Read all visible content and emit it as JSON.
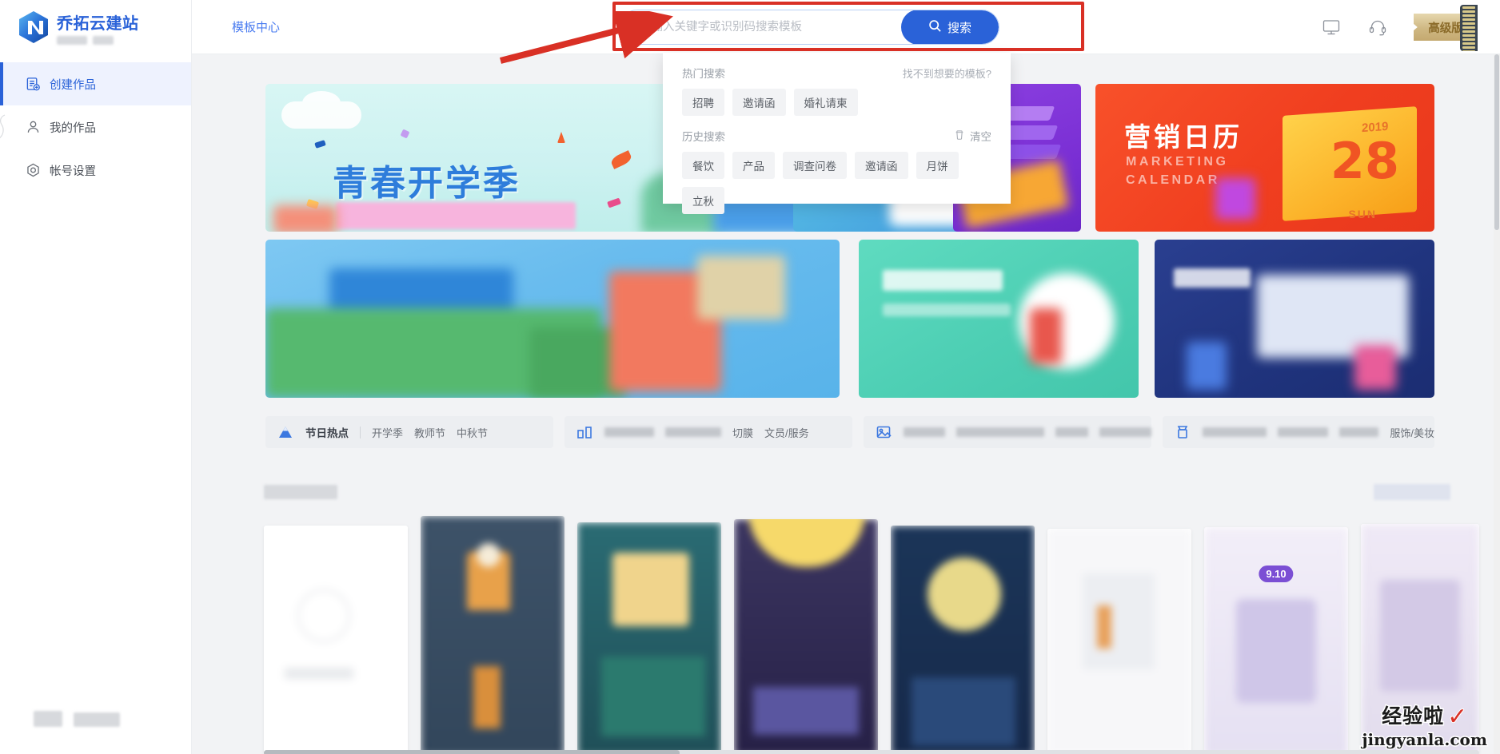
{
  "brand": {
    "title": "乔拓云建站",
    "logo_icon": "n-hexagon-logo"
  },
  "sidebar": {
    "items": [
      {
        "label": "创建作品",
        "icon": "create-document-icon",
        "active": true
      },
      {
        "label": "我的作品",
        "icon": "user-icon",
        "active": false
      },
      {
        "label": "帐号设置",
        "icon": "gear-hex-icon",
        "active": false
      }
    ]
  },
  "header": {
    "nav": [
      {
        "label": "模板中心"
      }
    ],
    "icons": [
      {
        "name": "monitor-icon",
        "title": "显示器"
      },
      {
        "name": "headset-icon",
        "title": "客服"
      }
    ],
    "premium_label": "高级版"
  },
  "search": {
    "placeholder": "请输入关键字或识别码搜索模板",
    "value": "",
    "button_label": "搜索",
    "button_icon": "search-icon"
  },
  "search_dropdown": {
    "hot": {
      "title": "热门搜索",
      "link": "找不到想要的模板?",
      "tags": [
        "招聘",
        "邀请函",
        "婚礼请柬"
      ]
    },
    "history": {
      "title": "历史搜索",
      "clear_label": "清空",
      "clear_icon": "trash-icon",
      "tags": [
        "餐饮",
        "产品",
        "调查问卷",
        "邀请函",
        "月饼",
        "立秋"
      ]
    }
  },
  "banners": {
    "main": {
      "title": "青春开学季"
    },
    "marketing": {
      "title": "营销日历",
      "subtitle_line1": "MARKETING",
      "subtitle_line2": "CALENDAR",
      "year": "2019",
      "day_number": "28",
      "weekday": "SUN"
    }
  },
  "tagbars": [
    {
      "icon": "mountain-hot-icon",
      "main": "节日热点",
      "items": [
        "开学季",
        "教师节",
        "中秋节"
      ],
      "blurred": []
    },
    {
      "icon": "industry-icon",
      "main": "",
      "items": [
        "切膜",
        "文员/服务"
      ],
      "blurred": [
        118,
        96,
        0,
        0
      ]
    },
    {
      "icon": "scene-icon",
      "main": "",
      "items": [],
      "blurred": [
        72,
        150,
        56,
        90
      ]
    },
    {
      "icon": "style-icon",
      "main": "",
      "items": [
        "服饰/美妆"
      ],
      "blurred": [
        118,
        110,
        80
      ]
    }
  ],
  "templates": {
    "badge_910": "9.10",
    "count": 8
  },
  "watermark": {
    "name": "经验啦",
    "check": "✓",
    "url": "jingyanla.com"
  },
  "colors": {
    "brand_blue": "#2a62d8",
    "nav_blue": "#4a7cf0",
    "accent_gold": "#c4a96f",
    "annotation_red": "#d93025",
    "badge_purple": "#7b4fd4",
    "page_bg": "#f2f3f5"
  }
}
